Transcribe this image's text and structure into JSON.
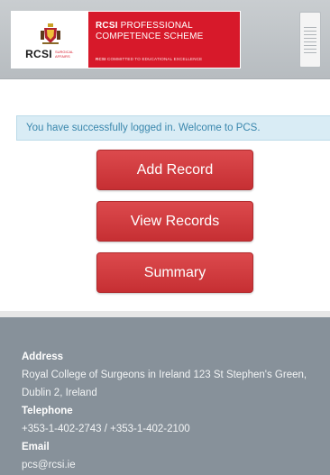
{
  "header": {
    "logo_text": "RCSI",
    "logo_sub": "Surgical Affairs",
    "banner_line1_bold": "RCSI",
    "banner_line1_rest": " PROFESSIONAL",
    "banner_line2": "COMPETENCE SCHEME",
    "banner_tagline_bold": "RCSI",
    "banner_tagline_rest": " COMMITTED TO EDUCATIONAL EXCELLENCE",
    "brand_red": "#d7192a"
  },
  "message": {
    "text": "You have successfully logged in. Welcome to PCS."
  },
  "actions": {
    "add_record": "Add Record",
    "view_records": "View Records",
    "summary": "Summary"
  },
  "footer": {
    "address_label": "Address",
    "address_value": "Royal College of Surgeons in Ireland 123 St Stephen's Green, Dublin 2, Ireland",
    "telephone_label": "Telephone",
    "telephone_value": "+353-1-402-2743 / +353-1-402-2100",
    "email_label": "Email",
    "email_value": "pcs@rcsi.ie"
  }
}
